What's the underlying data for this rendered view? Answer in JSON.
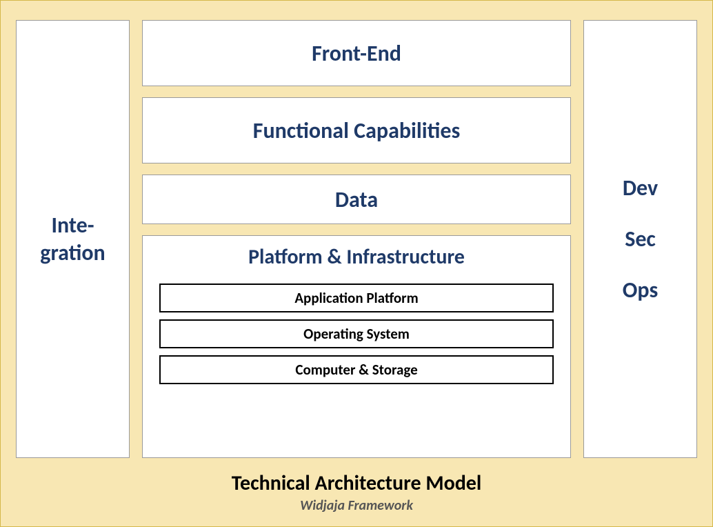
{
  "left": {
    "line1": "Inte-",
    "line2": "gration"
  },
  "right": {
    "line1": "Dev",
    "line2": "Sec",
    "line3": "Ops"
  },
  "layers": {
    "front": "Front-End",
    "functional": "Functional Capabilities",
    "data": "Data",
    "platform_title": "Platform & Infrastructure",
    "sublayers": {
      "app_platform": "Application Platform",
      "os": "Operating System",
      "compute_storage": "Computer & Storage"
    }
  },
  "footer": {
    "title": "Technical Architecture Model",
    "subtitle": "Widjaja Framework"
  }
}
